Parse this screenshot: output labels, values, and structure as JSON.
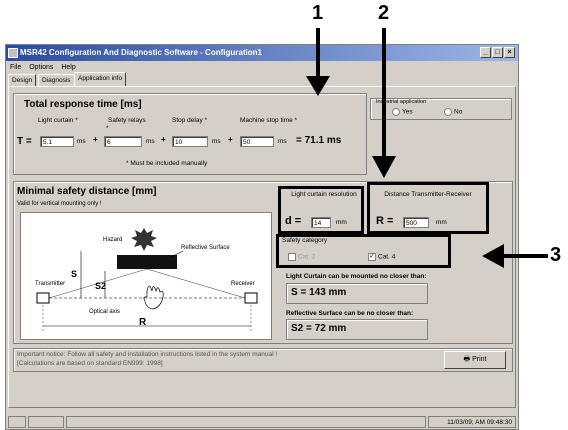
{
  "window": {
    "title": "MSR42 Configuration And Diagnostic Software - Configuration1"
  },
  "menu": [
    "File",
    "Options",
    "Help"
  ],
  "tabs": [
    "Design",
    "Diagnosis",
    "Application info"
  ],
  "annotations": {
    "n1": "1",
    "n2": "2",
    "n3": "3"
  },
  "response": {
    "title": "Total response time [ms]",
    "labels": {
      "light_curtain": "Light curtain *",
      "safety_relays": "Safety relays",
      "stop_delay": "Stop delay *",
      "machine_stop": "Machine stop time *"
    },
    "prefix": "T =",
    "values": {
      "light_curtain": "5.1",
      "safety_relays": "6",
      "stop_delay": "10",
      "machine_stop": "50"
    },
    "unit": "ms",
    "asterisk": "*",
    "plus": "+",
    "total": "= 71.1 ms",
    "note": "* Must be included manually"
  },
  "industrial": {
    "label": "Industrial application",
    "yes": "Yes",
    "no": "No"
  },
  "distance": {
    "title": "Minimal safety distance [mm]",
    "subtitle": "Valid for vertical mounting only !",
    "diagram": {
      "hazard": "Hazard",
      "reflective": "Reflective Surface",
      "transmitter": "Transmitter",
      "receiver": "Receiver",
      "optical_axis": "Optical axis",
      "s": "S",
      "s2": "S2",
      "r": "R"
    },
    "resolution": {
      "label": "Light curtain resolution",
      "prefix": "d =",
      "value": "14",
      "unit": "mm"
    },
    "tr": {
      "label": "Distance Transmitter-Receiver",
      "prefix": "R =",
      "value": "500",
      "unit": "mm"
    },
    "category": {
      "label": "Safety category",
      "cat2": "Cat. 2",
      "cat4": "Cat. 4"
    },
    "result1": {
      "label": "Light Curtain can be mounted no closer than:",
      "value": "S = 143 mm"
    },
    "result2": {
      "label": "Reflective Surface can be no closer than:",
      "value": "S2 = 72 mm"
    }
  },
  "notice": {
    "line1": "Important notice: Follow all safety and installation instructions listed in the system manual !",
    "line2": "[Calculations are based on standard EN999: 1998]"
  },
  "print_label": "Print",
  "status": {
    "datetime": "11/03/09; AM 09:48:30"
  }
}
